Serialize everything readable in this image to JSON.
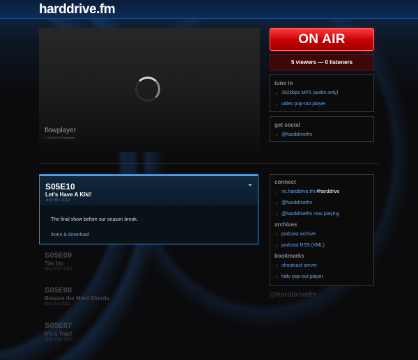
{
  "header": {
    "logo": "harddrive.fm"
  },
  "player": {
    "brand": "flowplayer",
    "copyright": "© 2008-2013 Flowplayer"
  },
  "status": {
    "on_air": "ON AIR",
    "viewers": "5 viewers — 0 listeners"
  },
  "tune_in": {
    "heading": "tune in",
    "links": [
      "192kbps MP3 (audio only)",
      "video pop-out player"
    ]
  },
  "social": {
    "heading": "get social",
    "links": [
      "@harddrivefm"
    ]
  },
  "connect": {
    "heading": "connect",
    "irc_prefix": "irc.harddrive.fm ",
    "irc_channel": "#harddrive",
    "links": [
      "@harddrivefm",
      "@harddrivefm now playing"
    ]
  },
  "archives": {
    "heading": "archives",
    "links": [
      "podcast archive",
      "podcast RSS (XML)"
    ]
  },
  "bookmarks": {
    "heading": "bookmarks",
    "links": [
      "shoutcast server",
      "hdtv pop-out player"
    ]
  },
  "twitter_handle": "@harddrivefm",
  "episodes": [
    {
      "code": "S05E10",
      "title": "Let's Have A Kiki!",
      "date": "July 8th 2013",
      "description": "The final show before our season break.",
      "action": "listen & download"
    },
    {
      "code": "S05E09",
      "title": "Tits Up",
      "date": "May 17th 2013"
    },
    {
      "code": "S05E08",
      "title": "Beware the Mind Shards",
      "date": "May 3rd 2013"
    },
    {
      "code": "S05E07",
      "title": "It's a Trap!",
      "date": "April 19th 2013"
    }
  ]
}
